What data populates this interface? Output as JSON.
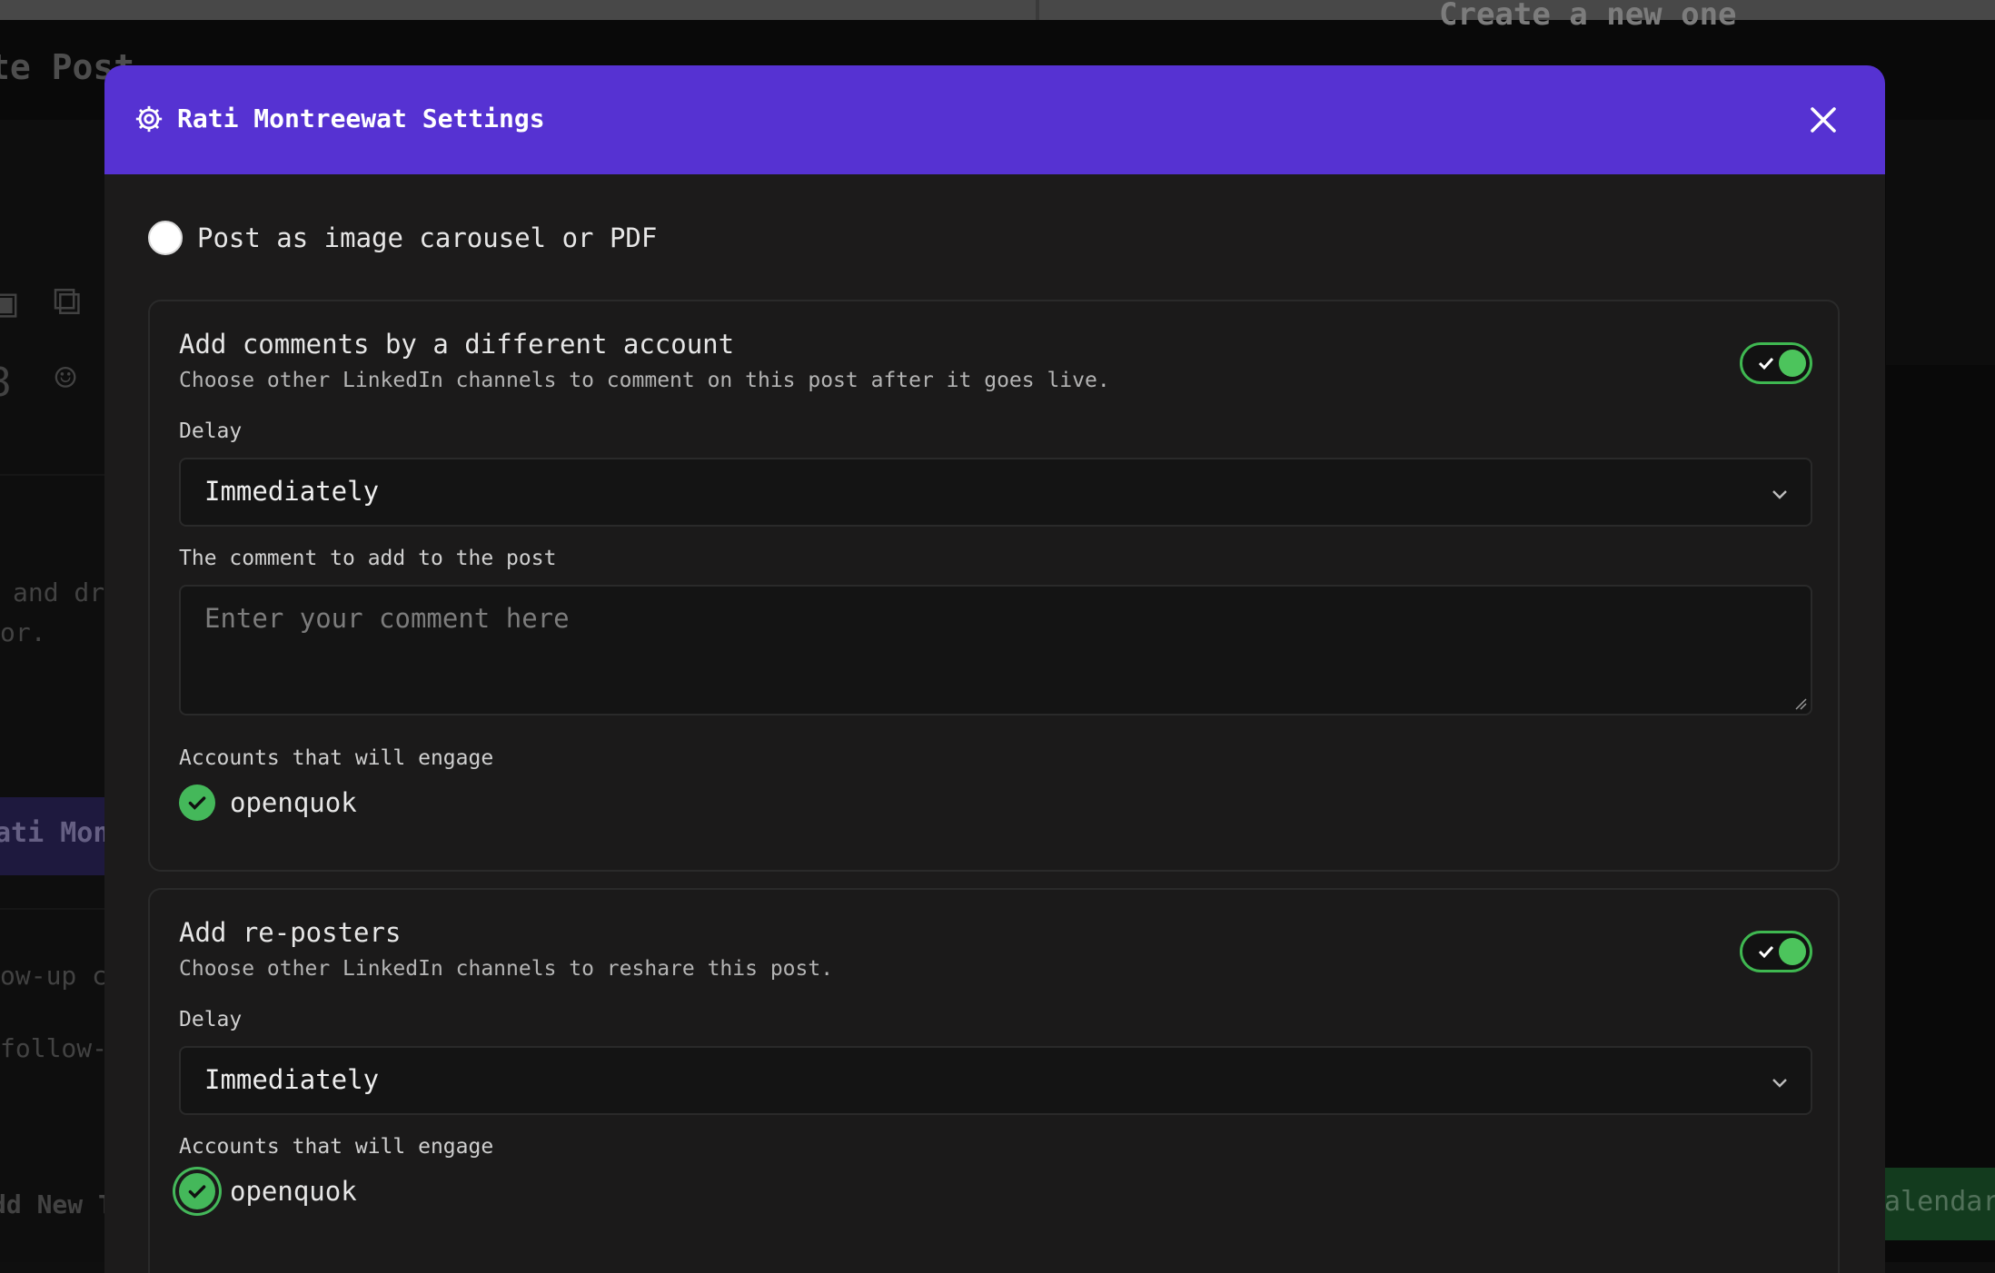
{
  "background": {
    "top_text": "Create a new one",
    "page_title": "te Post",
    "left_snippets": [
      "and dr",
      "or.",
      "ow-up co",
      "follow-",
      "dd New T"
    ],
    "selected_chip": "ati Mon",
    "calendar_button": "alendar"
  },
  "modal": {
    "title": "Rati Montreewat Settings",
    "header_color": "#5632d2",
    "carousel_option": {
      "label": "Post as image carousel or PDF",
      "selected": false
    },
    "comments_card": {
      "title": "Add comments by a different account",
      "description": "Choose other LinkedIn channels to comment on this post after it goes live.",
      "enabled": true,
      "delay_label": "Delay",
      "delay_value": "Immediately",
      "comment_label": "The comment to add to the post",
      "comment_placeholder": "Enter your comment here",
      "accounts_label": "Accounts that will engage",
      "accounts": [
        {
          "name": "openquok",
          "selected": true
        }
      ]
    },
    "reposters_card": {
      "title": "Add re-posters",
      "description": "Choose other LinkedIn channels to reshare this post.",
      "enabled": true,
      "delay_label": "Delay",
      "delay_value": "Immediately",
      "accounts_label": "Accounts that will engage",
      "accounts": [
        {
          "name": "openquok",
          "selected": true
        }
      ]
    }
  },
  "icons": {
    "header": "gear-icon",
    "close": "close-icon",
    "select": "chevron-down-icon",
    "account": "check-circle-icon",
    "toggle": "check-icon"
  },
  "colors": {
    "accent": "#5632d2",
    "success": "#44b85a",
    "surface": "#1c1b1b"
  }
}
